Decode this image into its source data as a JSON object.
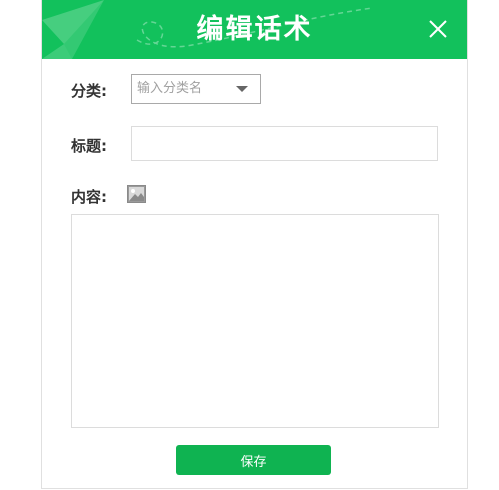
{
  "dialog": {
    "title": "编辑话术",
    "accent_color": "#12c15c",
    "close_icon": "close-icon"
  },
  "form": {
    "category_label": "分类:",
    "category_placeholder": "输入分类名",
    "title_label": "标题:",
    "title_value": "",
    "content_label": "内容:",
    "content_value": "",
    "image_icon": "image-icon"
  },
  "footer": {
    "save_label": "保存",
    "save_color": "#0fb351"
  }
}
